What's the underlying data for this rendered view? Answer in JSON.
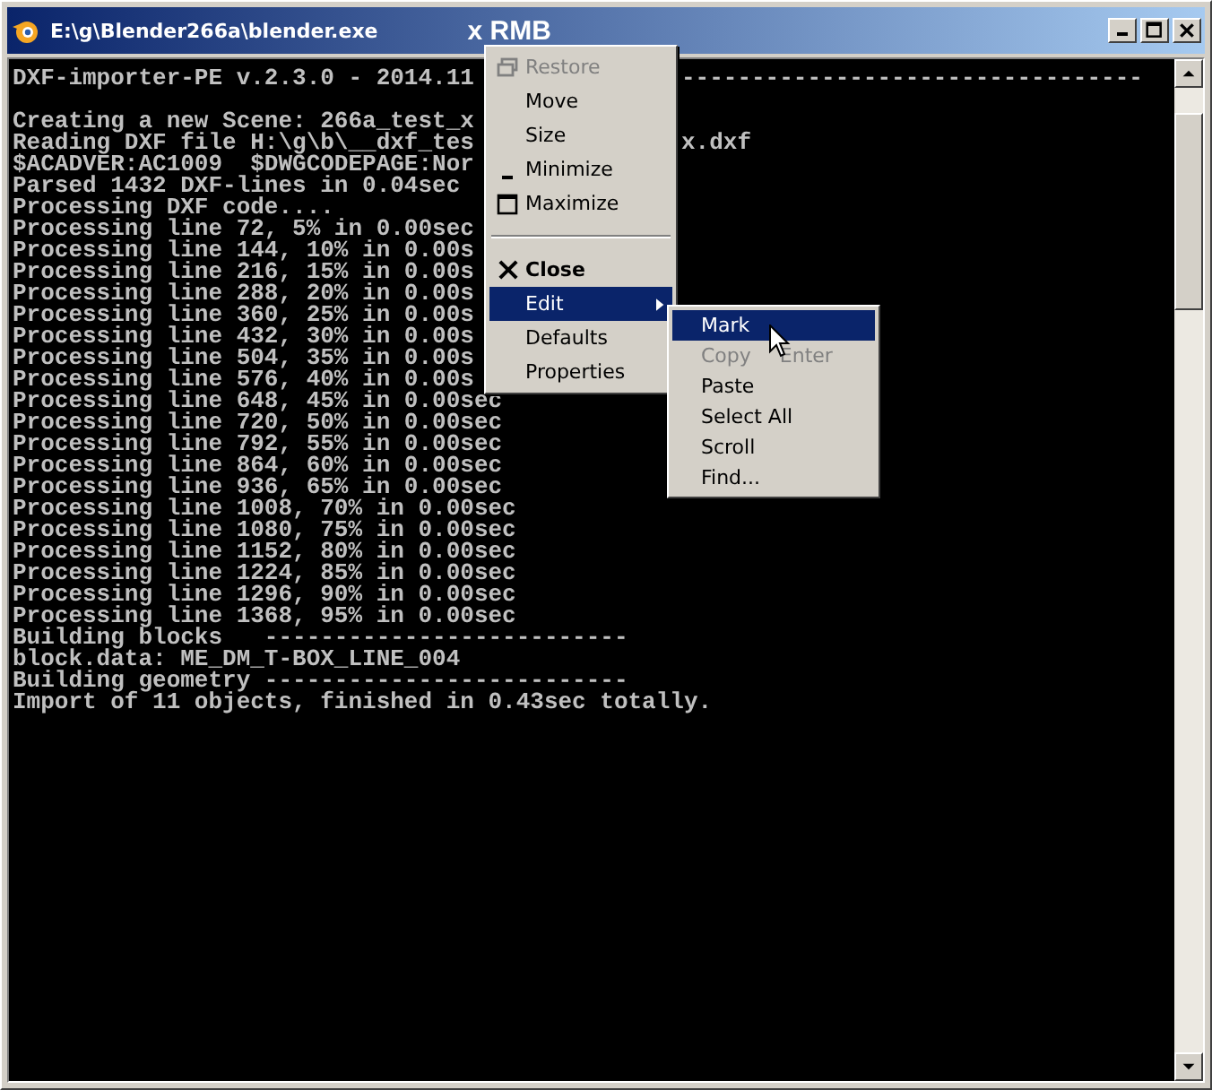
{
  "window": {
    "title": "E:\\g\\Blender266a\\blender.exe",
    "annotation": "x RMB"
  },
  "console": {
    "lines": [
      {
        "text": "DXF-importer-PE v.2.3.0 - 2014.11",
        "tail": "---------------------------------"
      },
      {
        "kind": "blank"
      },
      {
        "text": "Creating a new Scene: 266a_test_x"
      },
      {
        "text": "Reading DXF file H:\\g\\b\\__dxf_tes",
        "tail": "x.dxf"
      },
      {
        "text": "$ACADVER:AC1009  $DWGCODEPAGE:Nor"
      },
      {
        "text": "Parsed 1432 DXF-lines in 0.04sec"
      },
      {
        "text": "Processing DXF code...."
      },
      {
        "text": "Processing line 72, 5% in 0.00sec"
      },
      {
        "text": "Processing line 144, 10% in 0.00s"
      },
      {
        "text": "Processing line 216, 15% in 0.00s"
      },
      {
        "text": "Processing line 288, 20% in 0.00s"
      },
      {
        "text": "Processing line 360, 25% in 0.00s"
      },
      {
        "text": "Processing line 432, 30% in 0.00s"
      },
      {
        "text": "Processing line 504, 35% in 0.00s"
      },
      {
        "text": "Processing line 576, 40% in 0.00s"
      },
      {
        "text": "Processing line 648, 45% in 0.00sec"
      },
      {
        "text": "Processing line 720, 50% in 0.00sec"
      },
      {
        "text": "Processing line 792, 55% in 0.00sec"
      },
      {
        "text": "Processing line 864, 60% in 0.00sec"
      },
      {
        "text": "Processing line 936, 65% in 0.00sec"
      },
      {
        "text": "Processing line 1008, 70% in 0.00sec"
      },
      {
        "text": "Processing line 1080, 75% in 0.00sec"
      },
      {
        "text": "Processing line 1152, 80% in 0.00sec"
      },
      {
        "text": "Processing line 1224, 85% in 0.00sec"
      },
      {
        "text": "Processing line 1296, 90% in 0.00sec"
      },
      {
        "text": "Processing line 1368, 95% in 0.00sec"
      },
      {
        "text": "Building blocks   --------------------------"
      },
      {
        "text": "block.data: ME_DM_T-BOX_LINE_004"
      },
      {
        "text": "Building geometry --------------------------"
      },
      {
        "text": "Import of 11 objects, finished in 0.43sec totally."
      }
    ]
  },
  "system_menu": {
    "items": [
      {
        "kind": "restore",
        "label": "Restore",
        "disabled": true,
        "selected": false
      },
      {
        "kind": "plain",
        "label": "Move",
        "disabled": false,
        "selected": false
      },
      {
        "kind": "plain",
        "label": "Size",
        "disabled": false,
        "selected": false
      },
      {
        "kind": "minimize",
        "label": "Minimize",
        "disabled": false,
        "selected": false
      },
      {
        "kind": "maximize",
        "label": "Maximize",
        "disabled": false,
        "selected": false
      },
      {
        "kind": "separator"
      },
      {
        "kind": "close",
        "label": "Close",
        "disabled": false,
        "selected": false
      },
      {
        "kind": "submenu",
        "label": "Edit",
        "disabled": false,
        "selected": true
      },
      {
        "kind": "plain",
        "label": "Defaults",
        "disabled": false,
        "selected": false
      },
      {
        "kind": "plain",
        "label": "Properties",
        "disabled": false,
        "selected": false
      }
    ]
  },
  "edit_submenu": {
    "items": [
      {
        "label": "Mark",
        "disabled": false,
        "selected": true
      },
      {
        "label": "Copy",
        "shortcut": "Enter",
        "disabled": true,
        "selected": false
      },
      {
        "label": "Paste",
        "disabled": false,
        "selected": false
      },
      {
        "label": "Select All",
        "disabled": false,
        "selected": false
      },
      {
        "label": "Scroll",
        "disabled": false,
        "selected": false
      },
      {
        "label": "Find...",
        "disabled": false,
        "selected": false
      }
    ]
  }
}
